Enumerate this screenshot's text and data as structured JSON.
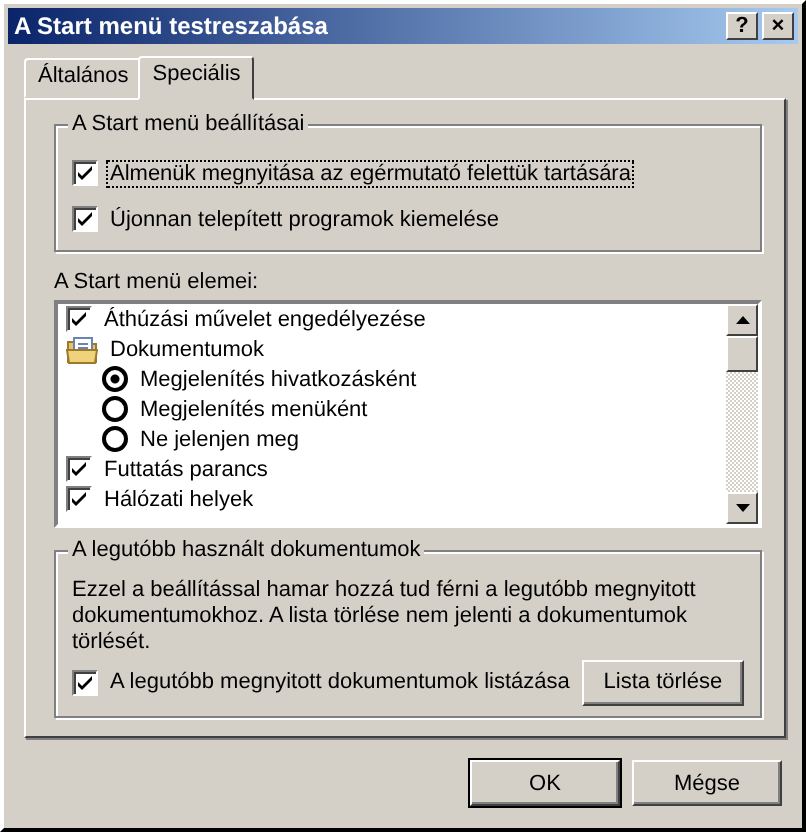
{
  "window": {
    "title": "A Start menü testreszabása",
    "title_buttons": [
      "?",
      "×"
    ]
  },
  "tabs": [
    {
      "label": "Általános",
      "selected": false
    },
    {
      "label": "Speciális",
      "selected": true
    }
  ],
  "settings_group": {
    "title": "A Start menü beállításai",
    "options": [
      {
        "label": "Almenük megnyitása az egérmutató felettük tartására",
        "checked": true,
        "focused": true
      },
      {
        "label": "Újonnan telepített programok kiemelése",
        "checked": true,
        "focused": false
      }
    ]
  },
  "items_list": {
    "label": "A Start menü elemei:",
    "items": [
      {
        "kind": "checkbox",
        "label": "Áthúzási művelet engedélyezése",
        "checked": true
      },
      {
        "kind": "folder",
        "label": "Dokumentumok",
        "children": [
          {
            "kind": "radio",
            "label": "Megjelenítés hivatkozásként",
            "selected": true
          },
          {
            "kind": "radio",
            "label": "Megjelenítés menüként",
            "selected": false
          },
          {
            "kind": "radio",
            "label": "Ne jelenjen meg",
            "selected": false
          }
        ]
      },
      {
        "kind": "checkbox",
        "label": "Futtatás parancs",
        "checked": true
      },
      {
        "kind": "checkbox",
        "label": "Hálózati helyek",
        "checked": true
      }
    ]
  },
  "recent_group": {
    "title": "A legutóbb használt dokumentumok",
    "description": "Ezzel a beállítással hamar hozzá tud férni a legutóbb megnyitott dokumentumokhoz.  A lista törlése nem jelenti a dokumentumok törlését.",
    "option": {
      "label": "A legutóbb megnyitott dokumentumok listázása",
      "checked": true
    },
    "button": "Lista törlése"
  },
  "buttons": [
    "OK",
    "Mégse"
  ]
}
